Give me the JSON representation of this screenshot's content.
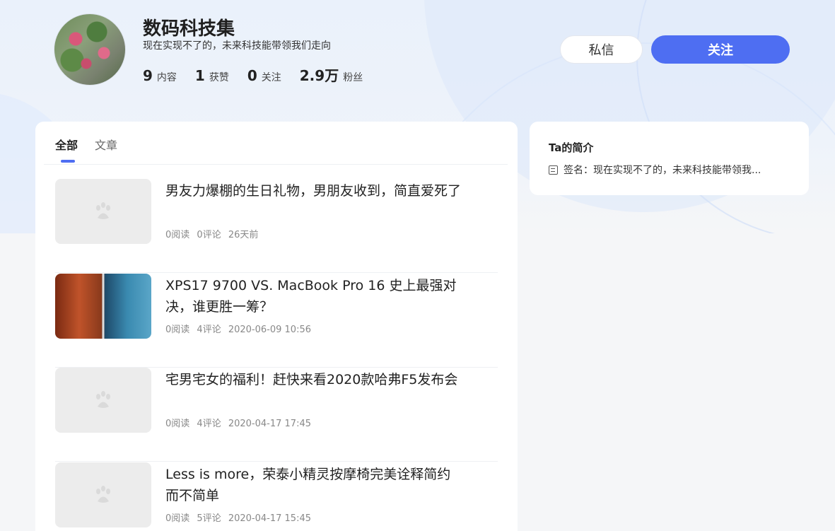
{
  "profile": {
    "name": "数码科技集",
    "motto": "现在实现不了的，未来科技能带领我们走向",
    "stats": [
      {
        "value": "9",
        "label": "内容"
      },
      {
        "value": "1",
        "label": "获赞"
      },
      {
        "value": "0",
        "label": "关注"
      },
      {
        "value": "2.9万",
        "label": "粉丝"
      }
    ]
  },
  "actions": {
    "message_label": "私信",
    "follow_label": "关注"
  },
  "tabs": [
    {
      "label": "全部",
      "active": true
    },
    {
      "label": "文章",
      "active": false
    }
  ],
  "articles": [
    {
      "title": "男友力爆棚的生日礼物，男朋友收到，简直爱死了",
      "reads": "0阅读",
      "comments": "0评论",
      "time": "26天前",
      "thumbnail": "placeholder-paw-icon"
    },
    {
      "title": "XPS17 9700 VS. MacBook Pro 16 史上最强对决，谁更胜一筹？",
      "reads": "0阅读",
      "comments": "4评论",
      "time": "2020-06-09 10:56",
      "thumbnail": "laptop-photo"
    },
    {
      "title": "宅男宅女的福利！赶快来看2020款哈弗F5发布会",
      "reads": "0阅读",
      "comments": "4评论",
      "time": "2020-04-17 17:45",
      "thumbnail": "placeholder-paw-icon"
    },
    {
      "title": "Less is more，荣泰小精灵按摩椅完美诠释简约而不简单",
      "reads": "0阅读",
      "comments": "5评论",
      "time": "2020-04-17 15:45",
      "thumbnail": "placeholder-paw-icon"
    }
  ],
  "sidebar": {
    "title": "Ta的简介",
    "signature": "签名：现在实现不了的，未来科技能带领我..."
  },
  "colors": {
    "accent": "#4e6ef2",
    "placeholder": "#ececec"
  }
}
